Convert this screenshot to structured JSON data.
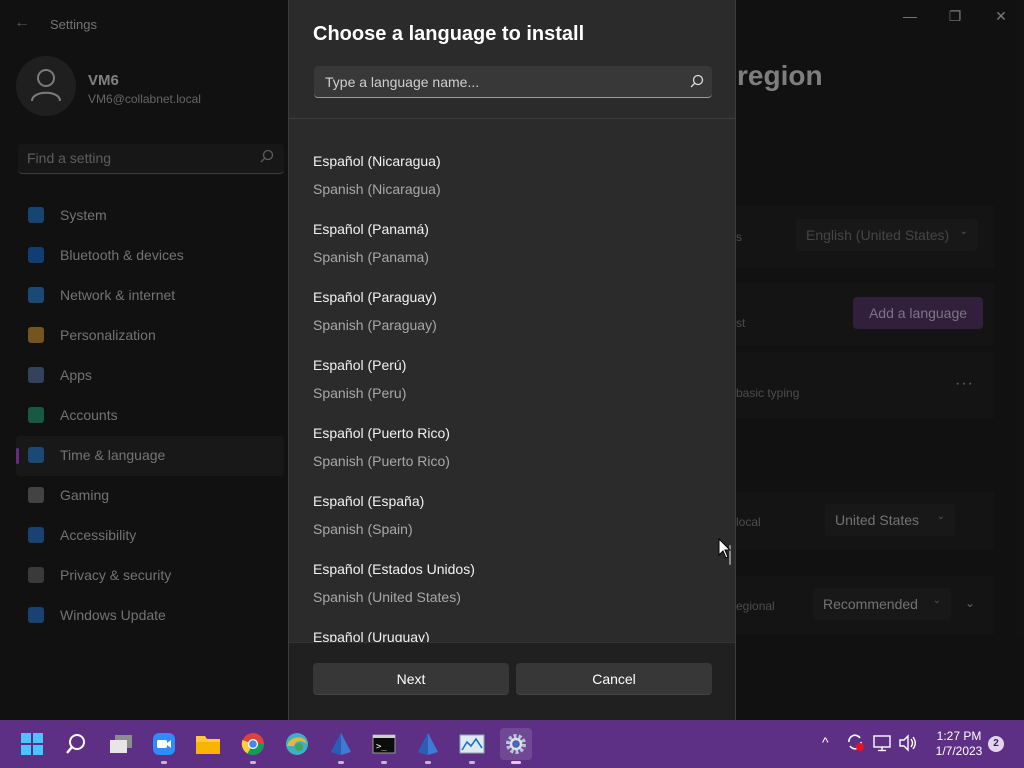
{
  "window": {
    "title": "Settings",
    "page_title": "region",
    "user": {
      "name": "VM6",
      "email": "VM6@collabnet.local"
    },
    "search_placeholder": "Find a setting",
    "nav": [
      {
        "label": "System",
        "color": "#2b7fd1"
      },
      {
        "label": "Bluetooth & devices",
        "color": "#1f6fcf"
      },
      {
        "label": "Network & internet",
        "color": "#2f86d4"
      },
      {
        "label": "Personalization",
        "color": "#d59b3a"
      },
      {
        "label": "Apps",
        "color": "#5b7ba7"
      },
      {
        "label": "Accounts",
        "color": "#2aa37a"
      },
      {
        "label": "Time & language",
        "color": "#2f86d4"
      },
      {
        "label": "Gaming",
        "color": "#7a7a7a"
      },
      {
        "label": "Accessibility",
        "color": "#2a79d1"
      },
      {
        "label": "Privacy & security",
        "color": "#6a6a6a"
      },
      {
        "label": "Windows Update",
        "color": "#2a79d1"
      }
    ],
    "active_nav": "Time & language",
    "background": {
      "display_language_value": "English (United States)",
      "add_language_label": "Add a language",
      "region_value": "United States",
      "format_value": "Recommended",
      "fragment_1": "s",
      "fragment_2": "st",
      "fragment_3": "basic typing",
      "fragment_4": "local",
      "fragment_5": "egional"
    }
  },
  "dialog": {
    "title": "Choose a language to install",
    "search_placeholder": "Type a language name...",
    "languages": [
      {
        "native": "Español (Nicaragua)",
        "english": "Spanish (Nicaragua)"
      },
      {
        "native": "Español (Panamá)",
        "english": "Spanish (Panama)"
      },
      {
        "native": "Español (Paraguay)",
        "english": "Spanish (Paraguay)"
      },
      {
        "native": "Español (Perú)",
        "english": "Spanish (Peru)"
      },
      {
        "native": "Español (Puerto Rico)",
        "english": "Spanish (Puerto Rico)"
      },
      {
        "native": "Español (España)",
        "english": "Spanish (Spain)"
      },
      {
        "native": "Español (Estados Unidos)",
        "english": "Spanish (United States)"
      },
      {
        "native": "Español (Uruguay)",
        "english": ""
      }
    ],
    "next_label": "Next",
    "cancel_label": "Cancel"
  },
  "taskbar": {
    "apps": [
      "start-icon",
      "search-icon",
      "task-view-icon",
      "zoom-icon",
      "file-explorer-icon",
      "chrome-icon",
      "edge-icon",
      "app-icon",
      "terminal-icon",
      "app-icon",
      "resource-monitor-icon",
      "settings-icon"
    ],
    "time": "1:27 PM",
    "date": "1/7/2023",
    "notification_count": "2"
  }
}
